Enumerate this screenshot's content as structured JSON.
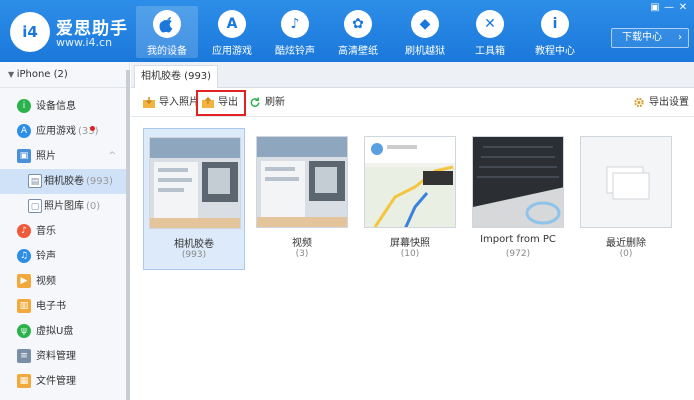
{
  "header": {
    "brand_name": "爱思助手",
    "brand_url": "www.i4.cn",
    "logo_text": "i4",
    "nav": [
      {
        "label": "我的设备",
        "icon": "apple-icon",
        "glyph": ""
      },
      {
        "label": "应用游戏",
        "icon": "app-store-icon",
        "glyph": "A"
      },
      {
        "label": "酷炫铃声",
        "icon": "bell-icon",
        "glyph": "♪"
      },
      {
        "label": "高清壁纸",
        "icon": "flower-icon",
        "glyph": "✿"
      },
      {
        "label": "刷机越狱",
        "icon": "box-icon",
        "glyph": "◆"
      },
      {
        "label": "工具箱",
        "icon": "tools-icon",
        "glyph": "✕"
      },
      {
        "label": "教程中心",
        "icon": "info-icon",
        "glyph": "i"
      }
    ],
    "download_center": "下载中心",
    "window_controls": [
      "▣",
      "—",
      "✕"
    ]
  },
  "sidebar": {
    "device": "iPhone (2)",
    "items": [
      {
        "label": "设备信息",
        "count": "",
        "color": "#2bb24c",
        "glyph": "i",
        "icon": "info-icon"
      },
      {
        "label": "应用游戏",
        "count": "(33)",
        "color": "#2d8ee8",
        "glyph": "A",
        "icon": "app-icon"
      },
      {
        "label": "照片",
        "count": "",
        "color": "#4a90d9",
        "glyph": "▣",
        "icon": "photo-icon"
      },
      {
        "label": "相机胶卷",
        "count": "(993)",
        "glyph": "▤",
        "icon": "camera-roll-icon"
      },
      {
        "label": "照片图库",
        "count": "(0)",
        "glyph": "▢",
        "icon": "photo-library-icon"
      },
      {
        "label": "音乐",
        "count": "",
        "color": "#f05a3a",
        "glyph": "♪",
        "icon": "music-icon"
      },
      {
        "label": "铃声",
        "count": "",
        "color": "#2d8ee8",
        "glyph": "♫",
        "icon": "bell-icon"
      },
      {
        "label": "视频",
        "count": "",
        "color": "#f2a93b",
        "glyph": "▶",
        "icon": "video-icon"
      },
      {
        "label": "电子书",
        "count": "",
        "color": "#f2a93b",
        "glyph": "▥",
        "icon": "book-icon"
      },
      {
        "label": "虚拟U盘",
        "count": "",
        "color": "#2bb24c",
        "glyph": "ψ",
        "icon": "usb-icon"
      },
      {
        "label": "资料管理",
        "count": "",
        "color": "#7a8ea6",
        "glyph": "≡",
        "icon": "data-icon"
      },
      {
        "label": "文件管理",
        "count": "",
        "color": "#f2a93b",
        "glyph": "▦",
        "icon": "folder-icon"
      }
    ]
  },
  "main": {
    "tab_label": "相机胶卷 (993)",
    "toolbar": {
      "import": "导入照片",
      "export": "导出",
      "refresh": "刷新",
      "export_settings": "导出设置"
    },
    "albums": [
      {
        "name": "相机胶卷",
        "count": "(993)"
      },
      {
        "name": "视频",
        "count": "(3)"
      },
      {
        "name": "屏幕快照",
        "count": "(10)"
      },
      {
        "name": "Import from PC",
        "count": "(972)"
      },
      {
        "name": "最近删除",
        "count": "(0)"
      }
    ]
  }
}
